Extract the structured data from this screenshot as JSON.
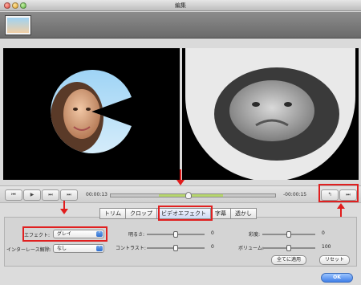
{
  "window": {
    "title": "編集"
  },
  "playback": {
    "time_current": "00:00:13",
    "time_remaining": "-00:00:15",
    "position_fraction": 0.47
  },
  "tabs": [
    {
      "label": "トリム"
    },
    {
      "label": "クロップ"
    },
    {
      "label": "ビデオエフェクト"
    },
    {
      "label": "字幕"
    },
    {
      "label": "透かし"
    }
  ],
  "effects": {
    "effect_label": "エフェクト:",
    "effect_value": "グレイ",
    "deinterlace_label": "インターレース解除:",
    "deinterlace_value": "なし",
    "brightness_label": "明るさ:",
    "brightness_value": "0",
    "contrast_label": "コントラスト:",
    "contrast_value": "0",
    "saturation_label": "彩度:",
    "saturation_value": "0",
    "volume_label": "ボリューム:",
    "volume_value": "100",
    "apply_all": "全てに適用",
    "reset": "リセット",
    "ok": "OK"
  },
  "colors": {
    "accent": "#3f7ee7",
    "highlight": "#e02020",
    "track_selection": "#b6d66d"
  }
}
